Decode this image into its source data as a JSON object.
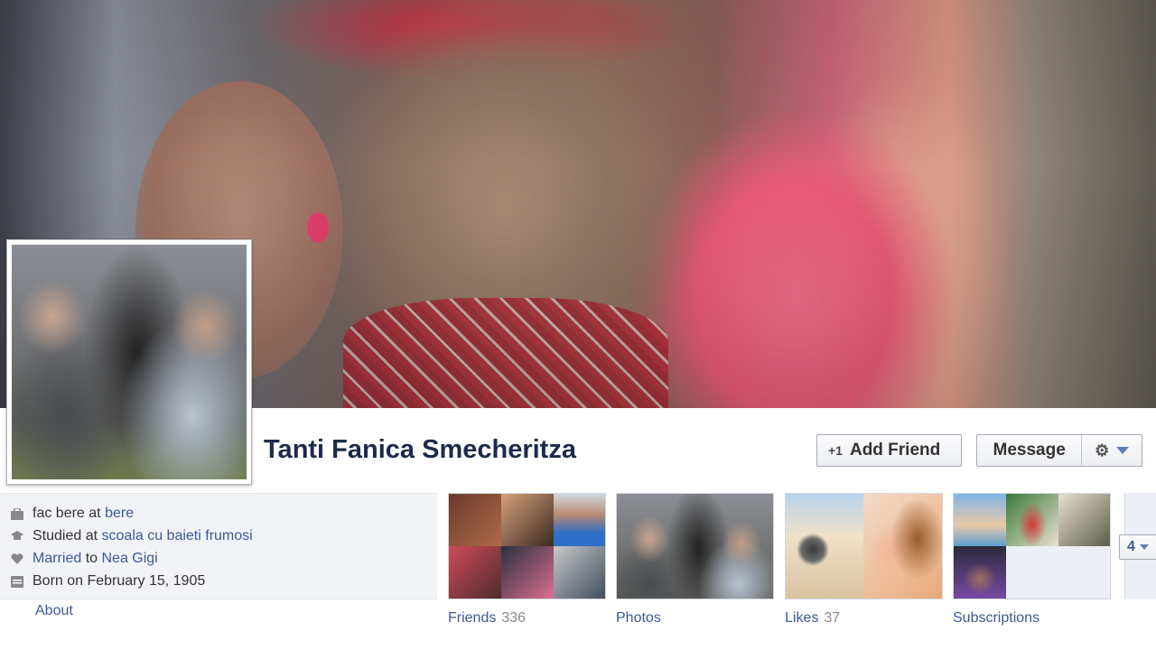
{
  "profile": {
    "name": "Tanti Fanica Smecheritza"
  },
  "actions": {
    "add_friend_icon": "+1",
    "add_friend_label": "Add Friend",
    "message_label": "Message",
    "gear_icon": "⚙"
  },
  "info": {
    "work_prefix": "fac bere at",
    "work_link": "bere",
    "study_prefix": "Studied at",
    "study_link": "scoala cu baieti frumosi",
    "married_link": "Married",
    "married_to": "to",
    "spouse_link": "Nea Gigi",
    "born": "Born on February 15, 1905"
  },
  "about_label": "About",
  "tiles": {
    "friends_label": "Friends",
    "friends_count": "336",
    "photos_label": "Photos",
    "likes_label": "Likes",
    "likes_count": "37",
    "subscriptions_label": "Subscriptions",
    "more_count": "4"
  },
  "colors": {
    "link": "#3b5998",
    "name": "#1c2b4b",
    "panel_bg": "#f2f3f7"
  },
  "icons": [
    "briefcase-icon",
    "graduation-icon",
    "heart-icon",
    "calendar-icon",
    "gear-icon",
    "chevron-down-icon"
  ]
}
